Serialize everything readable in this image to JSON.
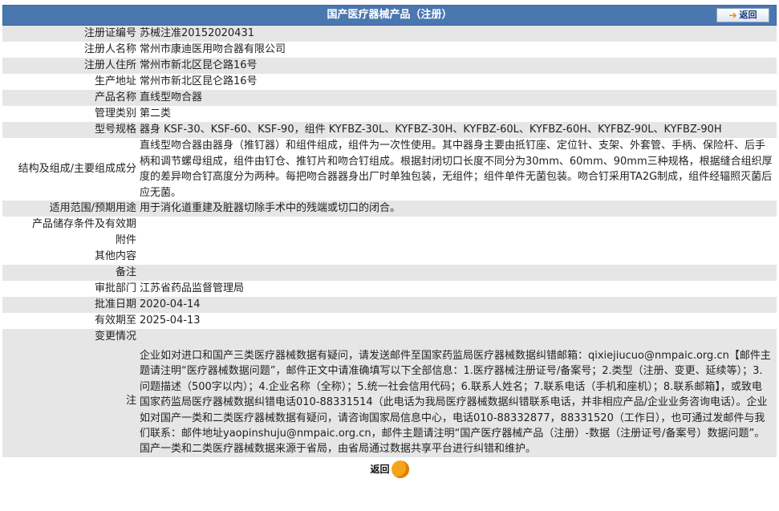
{
  "header": {
    "title": "国产医疗器械产品（注册）",
    "back_label": "返回"
  },
  "rows": [
    {
      "label": "注册证编号",
      "value": "苏械注准20152020431"
    },
    {
      "label": "注册人名称",
      "value": "常州市康迪医用吻合器有限公司"
    },
    {
      "label": "注册人住所",
      "value": "常州市新北区昆仑路16号"
    },
    {
      "label": "生产地址",
      "value": "常州市新北区昆仑路16号"
    },
    {
      "label": "产品名称",
      "value": "直线型吻合器"
    },
    {
      "label": "管理类别",
      "value": "第二类"
    },
    {
      "label": "型号规格",
      "value": "器身 KSF-30、KSF-60、KSF-90，组件 KYFBZ-30L、KYFBZ-30H、KYFBZ-60L、KYFBZ-60H、KYFBZ-90L、KYFBZ-90H"
    },
    {
      "label": "结构及组成/主要组成成分",
      "value": "直线型吻合器由器身（推钉器）和组件组成，组件为一次性使用。其中器身主要由抵钉座、定位针、支架、外套管、手柄、保险杆、后手柄和调节螺母组成，组件由钉仓、推钉片和吻合钉组成。根据封闭切口长度不同分为30mm、60mm、90mm三种规格，根据缝合组织厚度的差异吻合钉高度分为两种。每把吻合器器身出厂时单独包装，无组件；组件单件无菌包装。吻合钉采用TA2G制成，组件经辐照灭菌后应无菌。"
    },
    {
      "label": "适用范围/预期用途",
      "value": "用于消化道重建及脏器切除手术中的残端或切口的闭合。"
    },
    {
      "label": "产品储存条件及有效期",
      "value": ""
    },
    {
      "label": "附件",
      "value": ""
    },
    {
      "label": "其他内容",
      "value": ""
    },
    {
      "label": "备注",
      "value": ""
    },
    {
      "label": "审批部门",
      "value": "江苏省药品监督管理局"
    },
    {
      "label": "批准日期",
      "value": "2020-04-14"
    },
    {
      "label": "有效期至",
      "value": "2025-04-13"
    },
    {
      "label": "变更情况",
      "value": ""
    },
    {
      "label": "注",
      "value": "企业如对进口和国产三类医疗器械数据有疑问，请发送邮件至国家药监局医疗器械数据纠错邮箱：qixiejiucuo@nmpaic.org.cn【邮件主题请注明“医疗器械数据问题”，邮件正文中请准确填写以下全部信息：1.医疗器械注册证号/备案号；2.类型（注册、变更、延续等）；3.问题描述（500字以内）；4.企业名称（全称）；5.统一社会信用代码；6.联系人姓名；7.联系电话（手机和座机）；8.联系邮箱】，或致电国家药监局医疗器械数据纠错电话010-88331514（此电话为我局医疗器械数据纠错联系电话，并非相应产品/企业业务咨询电话）。企业如对国产一类和二类医疗器械数据有疑问，请咨询国家局信息中心，电话010-88332877，88331520（工作日），也可通过发邮件与我们联系：邮件地址yaopinshuju@nmpaic.org.cn，邮件主题请注明“国产医疗器械产品（注册）-数据（注册证号/备案号）数据问题”。国产一类和二类医疗器械数据来源于省局，由省局通过数据共享平台进行纠错和维护。"
    }
  ],
  "footer": {
    "back_label": "返回"
  },
  "colors": {
    "header_bg": "#4a77b0",
    "row_alt": "#e6e6e6",
    "accent": "#f6a51b"
  },
  "icons": {
    "back_top": "arrow-right-icon",
    "back_bottom": "orange-circle-icon"
  }
}
